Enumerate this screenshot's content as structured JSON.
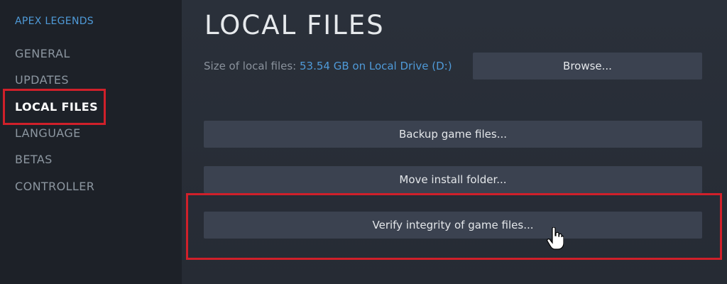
{
  "sidebar": {
    "game_title": "APEX LEGENDS",
    "items": [
      {
        "label": "GENERAL"
      },
      {
        "label": "UPDATES"
      },
      {
        "label": "LOCAL FILES",
        "active": true
      },
      {
        "label": "LANGUAGE"
      },
      {
        "label": "BETAS"
      },
      {
        "label": "CONTROLLER"
      }
    ]
  },
  "main": {
    "title": "LOCAL FILES",
    "size_label": "Size of local files:",
    "size_value": "53.54 GB on Local Drive (D:)",
    "browse_label": "Browse...",
    "backup_label": "Backup game files...",
    "move_label": "Move install folder...",
    "verify_label": "Verify integrity of game files..."
  },
  "colors": {
    "accent": "#4f9ad8",
    "highlight": "#d0202a",
    "button_bg": "#3b4250"
  },
  "icons": {
    "cursor": "hand-pointer-icon"
  }
}
